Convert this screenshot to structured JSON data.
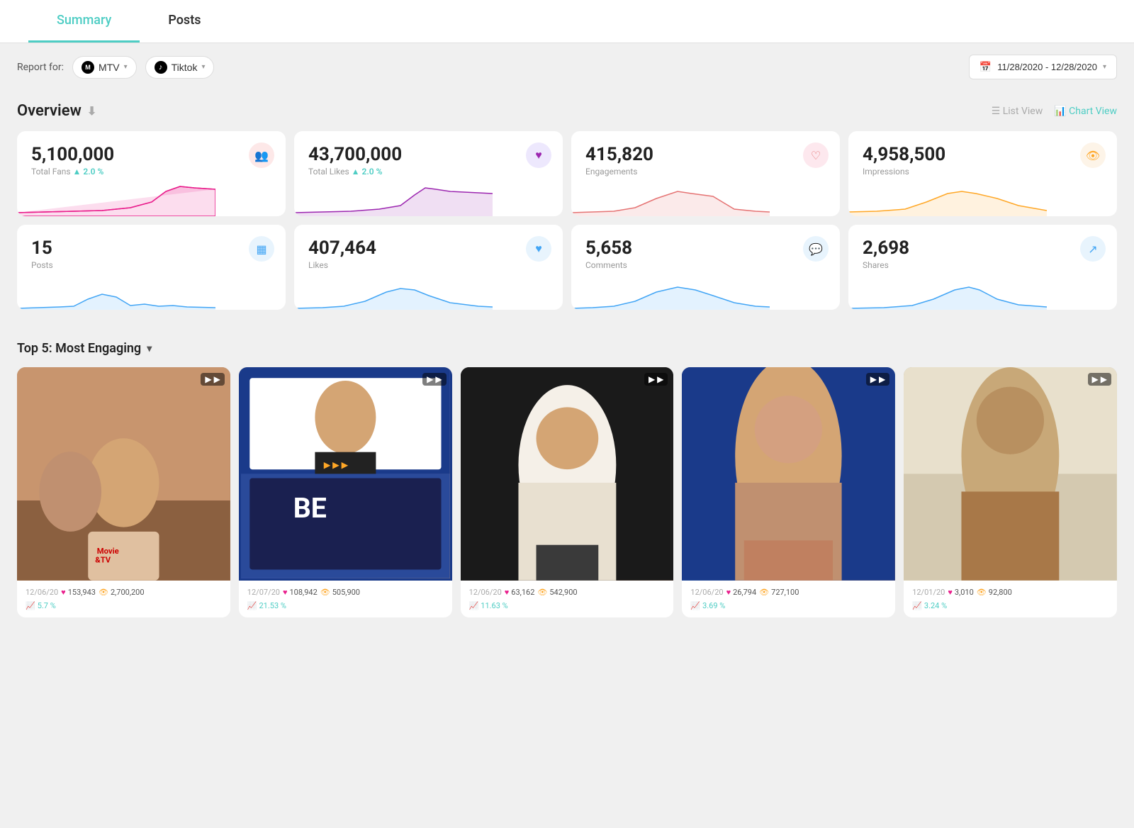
{
  "tabs": [
    {
      "label": "Summary",
      "active": true
    },
    {
      "label": "Posts",
      "active": false
    }
  ],
  "toolbar": {
    "report_label": "Report for:",
    "channel": "MTV",
    "platform": "Tiktok",
    "date_range": "11/28/2020 - 12/28/2020"
  },
  "overview": {
    "title": "Overview",
    "list_view_label": "List View",
    "chart_view_label": "Chart View",
    "cards_row1": [
      {
        "value": "5,100,000",
        "label": "Total Fans",
        "change": "▲ 2.0 %",
        "icon": "👥",
        "icon_class": "icon-pink",
        "chart_color": "pink"
      },
      {
        "value": "43,700,000",
        "label": "Total Likes",
        "change": "▲ 2.0 %",
        "icon": "♥",
        "icon_class": "icon-purple",
        "chart_color": "purple"
      },
      {
        "value": "415,820",
        "label": "Engagements",
        "change": "",
        "icon": "♡",
        "icon_class": "icon-rose",
        "chart_color": "rose"
      },
      {
        "value": "4,958,500",
        "label": "Impressions",
        "change": "",
        "icon": "👁",
        "icon_class": "icon-amber",
        "chart_color": "amber"
      }
    ],
    "cards_row2": [
      {
        "value": "15",
        "label": "Posts",
        "change": "",
        "icon": "▦",
        "icon_class": "icon-blue",
        "chart_color": "blue"
      },
      {
        "value": "407,464",
        "label": "Likes",
        "change": "",
        "icon": "♥",
        "icon_class": "icon-blue",
        "chart_color": "blue"
      },
      {
        "value": "5,658",
        "label": "Comments",
        "change": "",
        "icon": "💬",
        "icon_class": "icon-blue",
        "chart_color": "blue"
      },
      {
        "value": "2,698",
        "label": "Shares",
        "change": "",
        "icon": "↗",
        "icon_class": "icon-blue",
        "chart_color": "blue"
      }
    ]
  },
  "top5": {
    "title": "Top 5: Most Engaging",
    "posts": [
      {
        "date": "12/06/20",
        "likes": "153,943",
        "views": "2,700,200",
        "growth": "5.7 %",
        "img_class": "img-warm1"
      },
      {
        "date": "12/07/20",
        "likes": "108,942",
        "views": "505,900",
        "growth": "21.53 %",
        "img_class": "img-blue1"
      },
      {
        "date": "12/06/20",
        "likes": "63,162",
        "views": "542,900",
        "growth": "11.63 %",
        "img_class": "img-dark1"
      },
      {
        "date": "12/06/20",
        "likes": "26,794",
        "views": "727,100",
        "growth": "3.69 %",
        "img_class": "img-blue2"
      },
      {
        "date": "12/01/20",
        "likes": "3,010",
        "views": "92,800",
        "growth": "3.24 %",
        "img_class": "img-light1"
      }
    ]
  }
}
